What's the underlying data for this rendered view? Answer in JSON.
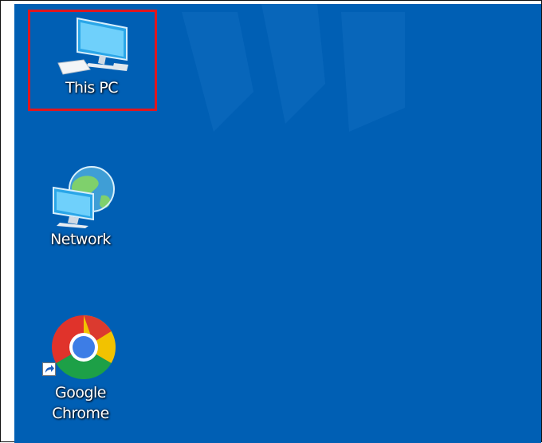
{
  "desktop": {
    "background_color": "#005fb4",
    "highlight_color": "#e0161e",
    "icons": [
      {
        "label": "This PC",
        "icon": "computer-icon",
        "selected": true
      },
      {
        "label": "Network",
        "icon": "network-icon",
        "selected": false
      },
      {
        "label": "Google\nChrome",
        "label_line1": "Google",
        "label_line2": "Chrome",
        "icon": "chrome-icon",
        "shortcut": true,
        "selected": false
      }
    ]
  }
}
